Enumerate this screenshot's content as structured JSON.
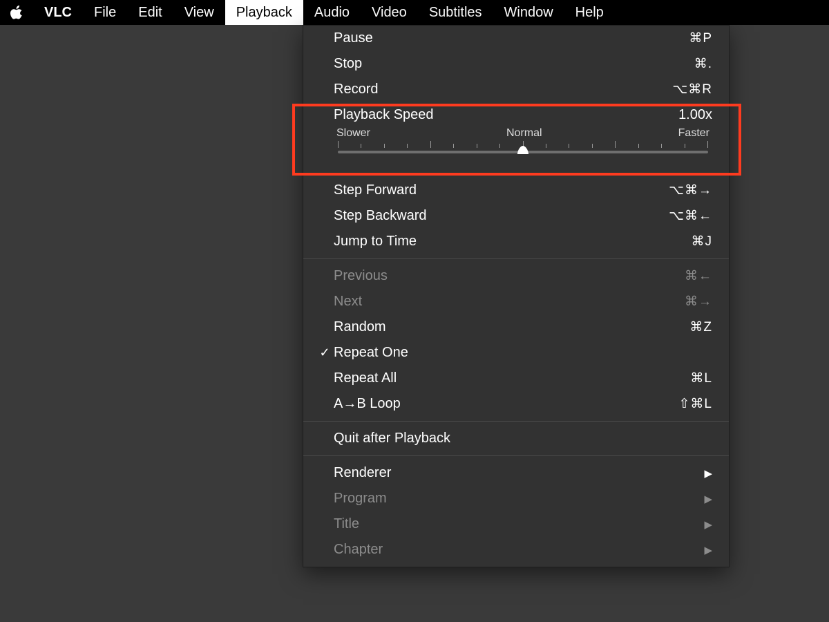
{
  "menubar": {
    "app": "VLC",
    "items": [
      "File",
      "Edit",
      "View",
      "Playback",
      "Audio",
      "Video",
      "Subtitles",
      "Window",
      "Help"
    ],
    "active": "Playback"
  },
  "dropdown": {
    "group1": [
      {
        "label": "Pause",
        "shortcut": "⌘P"
      },
      {
        "label": "Stop",
        "shortcut": "⌘."
      },
      {
        "label": "Record",
        "shortcut": "⌥⌘R"
      }
    ],
    "speed": {
      "title": "Playback Speed",
      "value": "1.00x",
      "lbl_slower": "Slower",
      "lbl_normal": "Normal",
      "lbl_faster": "Faster"
    },
    "group2": [
      {
        "label": "Step Forward",
        "shortcut": "⌥⌘→"
      },
      {
        "label": "Step Backward",
        "shortcut": "⌥⌘←"
      },
      {
        "label": "Jump to Time",
        "shortcut": "⌘J"
      }
    ],
    "group3": [
      {
        "label": "Previous",
        "shortcut": "⌘←",
        "disabled": true
      },
      {
        "label": "Next",
        "shortcut": "⌘→",
        "disabled": true
      },
      {
        "label": "Random",
        "shortcut": "⌘Z"
      },
      {
        "label": "Repeat One",
        "checked": true
      },
      {
        "label": "Repeat All",
        "shortcut": "⌘L"
      },
      {
        "label": "A→B Loop",
        "shortcut": "⇧⌘L"
      }
    ],
    "group4": [
      {
        "label": "Quit after Playback"
      }
    ],
    "group5": [
      {
        "label": "Renderer",
        "submenu": true
      },
      {
        "label": "Program",
        "submenu": true,
        "disabled": true
      },
      {
        "label": "Title",
        "submenu": true,
        "disabled": true
      },
      {
        "label": "Chapter",
        "submenu": true,
        "disabled": true
      }
    ]
  }
}
